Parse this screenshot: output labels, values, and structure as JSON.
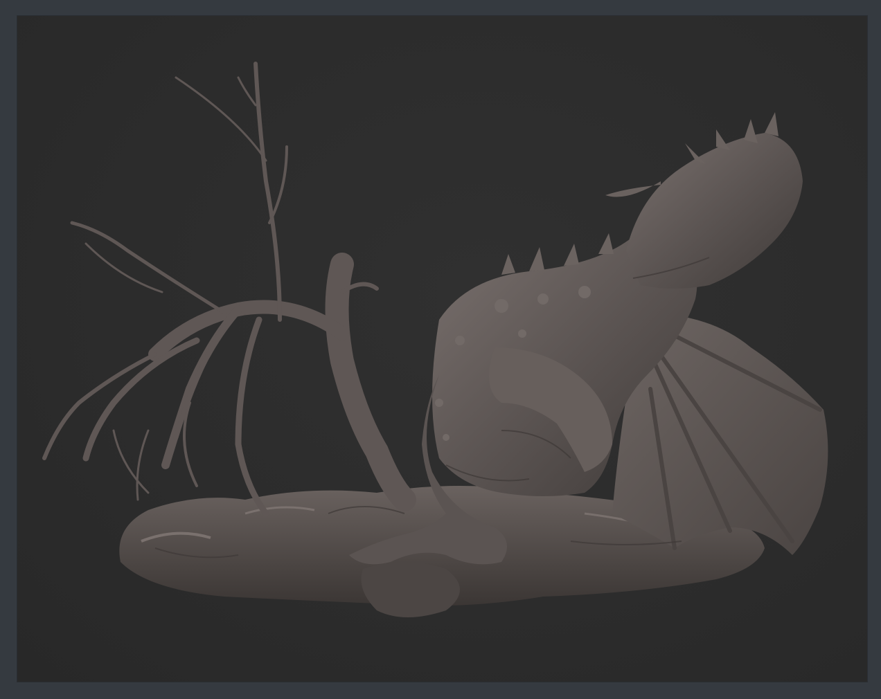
{
  "app": {
    "frame_color": "#353a40",
    "viewport_color": "#2c2c2c"
  },
  "viewport": {
    "content": "sculpt-render",
    "model_color": "#5b5452",
    "model_shadow_color": "#3a3533",
    "model_highlight_color": "#7c7370"
  }
}
